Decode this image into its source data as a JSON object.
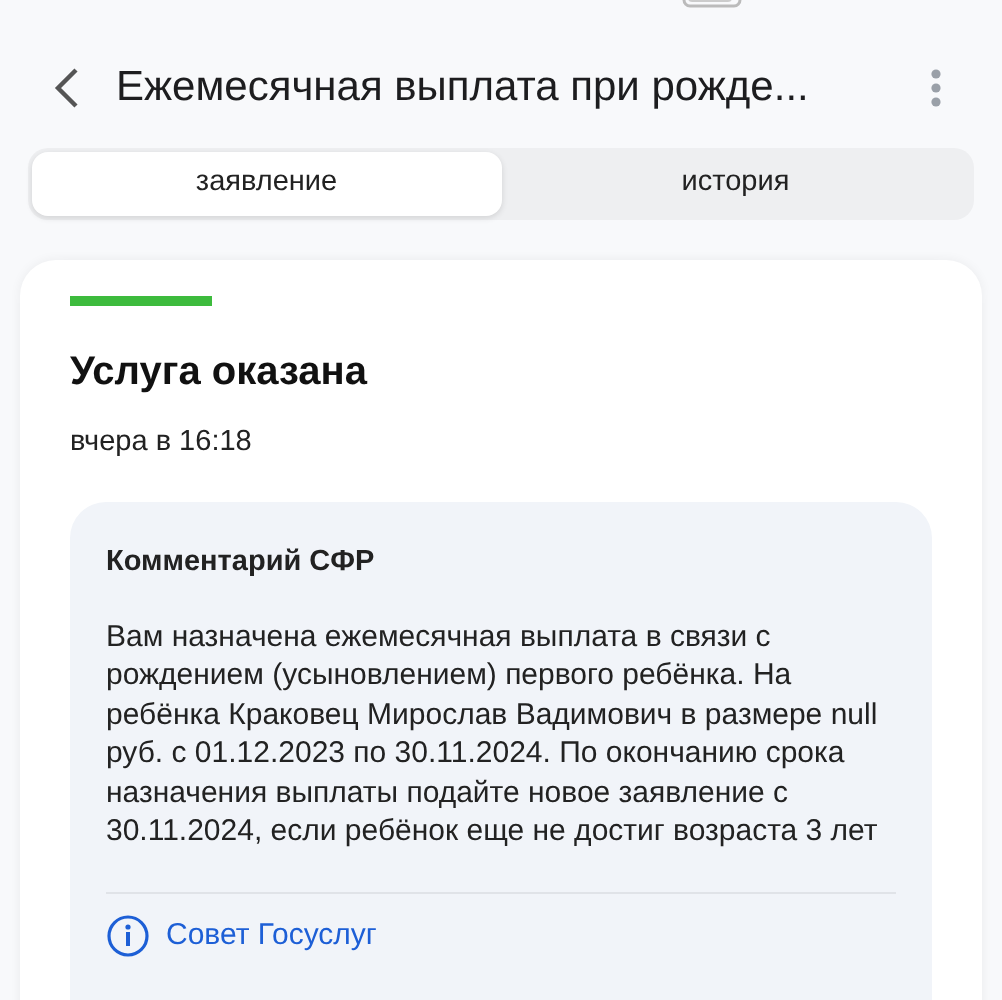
{
  "header": {
    "title": "Ежемесячная выплата при рожде..."
  },
  "tabs": [
    {
      "label": "заявление",
      "selected": true
    },
    {
      "label": "история",
      "selected": false
    }
  ],
  "status": {
    "title": "Услуга оказана",
    "time": "вчера в 16:18",
    "color": "#3dbb3d"
  },
  "comment": {
    "title": "Комментарий СФР",
    "text": "Вам назначена ежемесячная выплата в связи с рождением (усыновлением) первого ребёнка. На ребёнка Краковец Мирослав Вадимович в размере null руб. с 01.12.2023 по 30.11.2024. По окончанию срока назначения выплаты подайте новое заявление с 30.11.2024, если ребёнок еще не достиг возраста 3 лет",
    "link": "Совет Госуслуг"
  }
}
